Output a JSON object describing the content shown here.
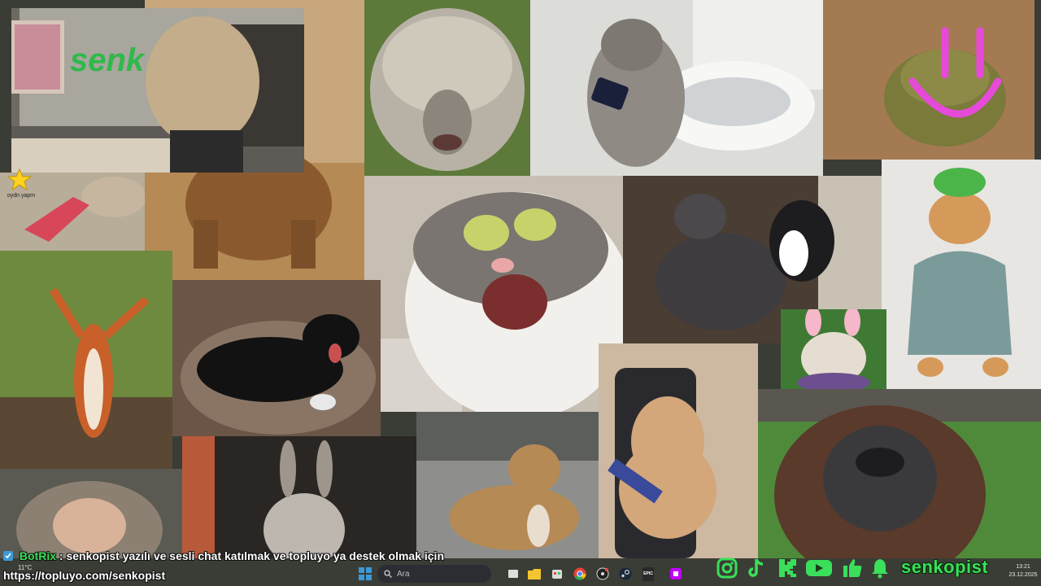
{
  "webcam": {
    "sign_text": "senk"
  },
  "star_overlay": {
    "label": "oydn yapm"
  },
  "chat": {
    "bot_name": "BotRix",
    "message": ": senkopist yazılı ve sesli chat katılmak ve topluyo ya destek olmak için",
    "link": "https://topluyo.com/senkopist"
  },
  "weather": {
    "temperature": "11°C"
  },
  "taskbar": {
    "search_placeholder": "Ara",
    "items": [
      "start-icon",
      "search-icon",
      "task-view-icon",
      "file-explorer-icon",
      "store-icon",
      "chrome-icon",
      "obs-icon",
      "steam-icon",
      "epic-games-icon",
      "twitch-icon"
    ],
    "epic_label": "EPIC"
  },
  "social": {
    "icons": [
      "instagram-icon",
      "tiktok-icon",
      "kick-icon",
      "youtube-icon",
      "like-icon",
      "bell-icon"
    ],
    "channel_name": "senkopist",
    "accent": "#3adf5a"
  },
  "clock": {
    "time": "13:21",
    "date": "23.12.2025"
  },
  "colors": {
    "taskbar": "#1f2328",
    "brand_green": "#3adf5a",
    "smile_pink": "#e64ad8"
  }
}
